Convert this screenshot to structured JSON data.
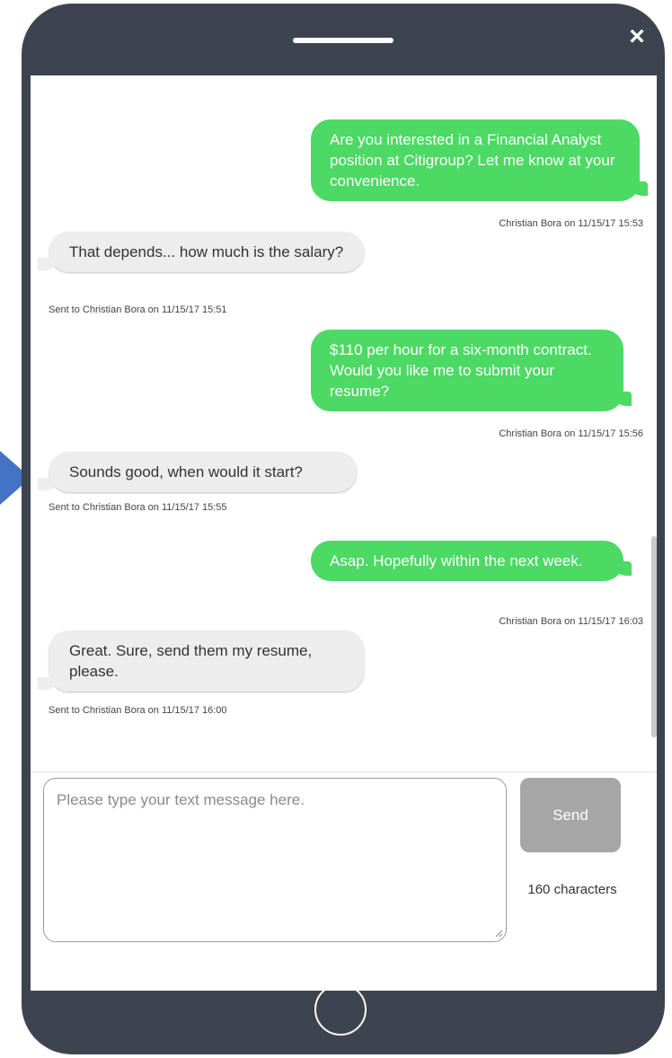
{
  "window": {
    "close_icon": "×"
  },
  "messages": [
    {
      "direction": "sent",
      "text": "Are you interested in a Financial Analyst position at Citigroup? Let me know at your convenience.",
      "meta": "Christian Bora on 11/15/17 15:53"
    },
    {
      "direction": "received",
      "text": "That depends... how much is the salary?",
      "meta": "Sent to Christian Bora on 11/15/17 15:51"
    },
    {
      "direction": "sent",
      "text": "$110 per hour for a six-month contract. Would you like me to submit your resume?",
      "meta": "Christian Bora on 11/15/17 15:56"
    },
    {
      "direction": "received",
      "text": "Sounds good, when would it start?",
      "meta": "Sent to Christian Bora on 11/15/17 15:55"
    },
    {
      "direction": "sent",
      "text": "Asap. Hopefully within the next week.",
      "meta": "Christian Bora on 11/15/17 16:03"
    },
    {
      "direction": "received",
      "text": "Great. Sure, send them my resume, please.",
      "meta": "Sent to Christian Bora on 11/15/17 16:00"
    }
  ],
  "composer": {
    "value": "",
    "placeholder": "Please type your text message here.",
    "send_label": "Send",
    "char_count": "160 characters"
  },
  "colors": {
    "phone_frame": "#3d4450",
    "sent_bubble": "#4cd964",
    "received_bubble": "#ededed",
    "send_button": "#a6a6a6",
    "arrow": "#4472c4"
  },
  "icons": {
    "close": "close-icon",
    "home": "home-button-icon",
    "speaker": "speaker-slot",
    "arrow": "arrow-right-icon"
  }
}
